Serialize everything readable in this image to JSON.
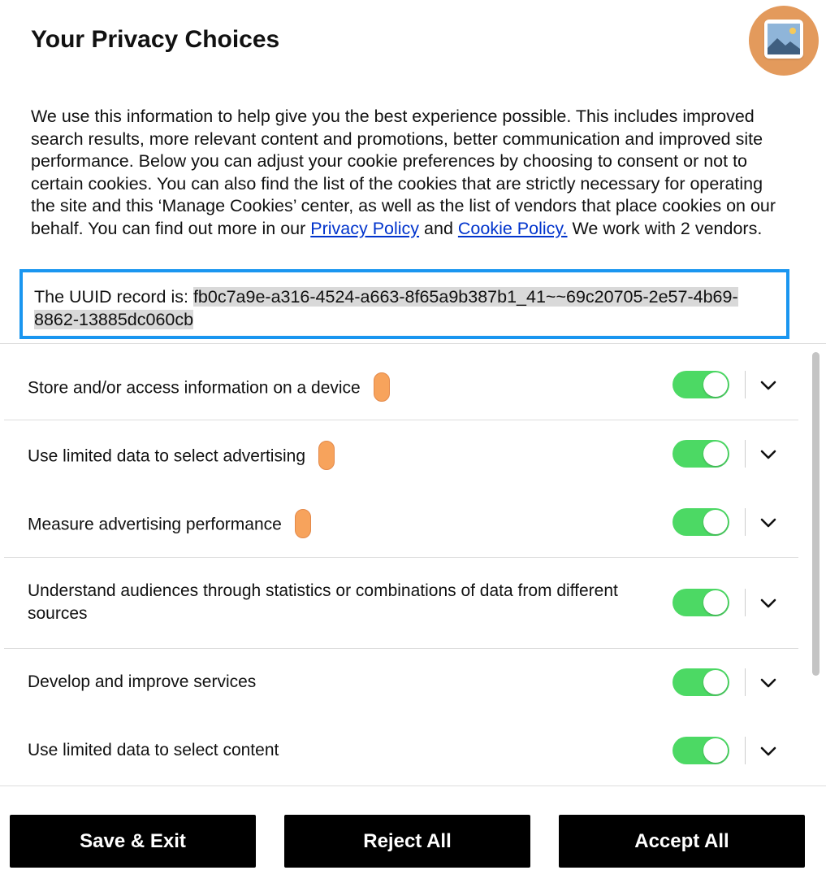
{
  "header": {
    "title": "Your Privacy Choices",
    "logo_icon": "image-placeholder-icon"
  },
  "intro": {
    "text_before": "We use this information to help give you the best experience possible. This includes improved search results, more relevant content and promotions, better communication and improved site performance. Below you can adjust your cookie preferences by choosing to consent or not to certain cookies. You can also find the list of the cookies that are strictly necessary for operating the site and this ‘Manage Cookies’ center, as well as the list of vendors that place cookies on our behalf. You can find out more in our ",
    "privacy_link": "Privacy Policy",
    "text_middle": " and ",
    "cookie_link": "Cookie Policy.",
    "text_after": " We work with 2 vendors."
  },
  "uuid": {
    "label": "The UUID record is: ",
    "value": "fb0c7a9e-a316-4524-a663-8f65a9b387b1_41~~69c20705-2e57-4b69-8862-13885dc060cb"
  },
  "purposes": [
    {
      "label": "Store and/or access information on a device",
      "legitimate_interest": true,
      "enabled": true
    },
    {
      "label": "Use limited data to select advertising",
      "legitimate_interest": true,
      "enabled": true
    },
    {
      "label": "Measure advertising performance",
      "legitimate_interest": true,
      "enabled": true
    },
    {
      "label": "Understand audiences through statistics or combinations of data from different sources",
      "legitimate_interest": false,
      "enabled": true
    },
    {
      "label": "Develop and improve services",
      "legitimate_interest": false,
      "enabled": true
    },
    {
      "label": "Use limited data to select content",
      "legitimate_interest": false,
      "enabled": true
    }
  ],
  "colors": {
    "toggle_on": "#4cd964",
    "pill": "#f7a35c",
    "uuid_border": "#1a96f0",
    "link": "#0033cc",
    "button_bg": "#000000"
  },
  "footer": {
    "save_label": "Save & Exit",
    "reject_label": "Reject All",
    "accept_label": "Accept All"
  }
}
